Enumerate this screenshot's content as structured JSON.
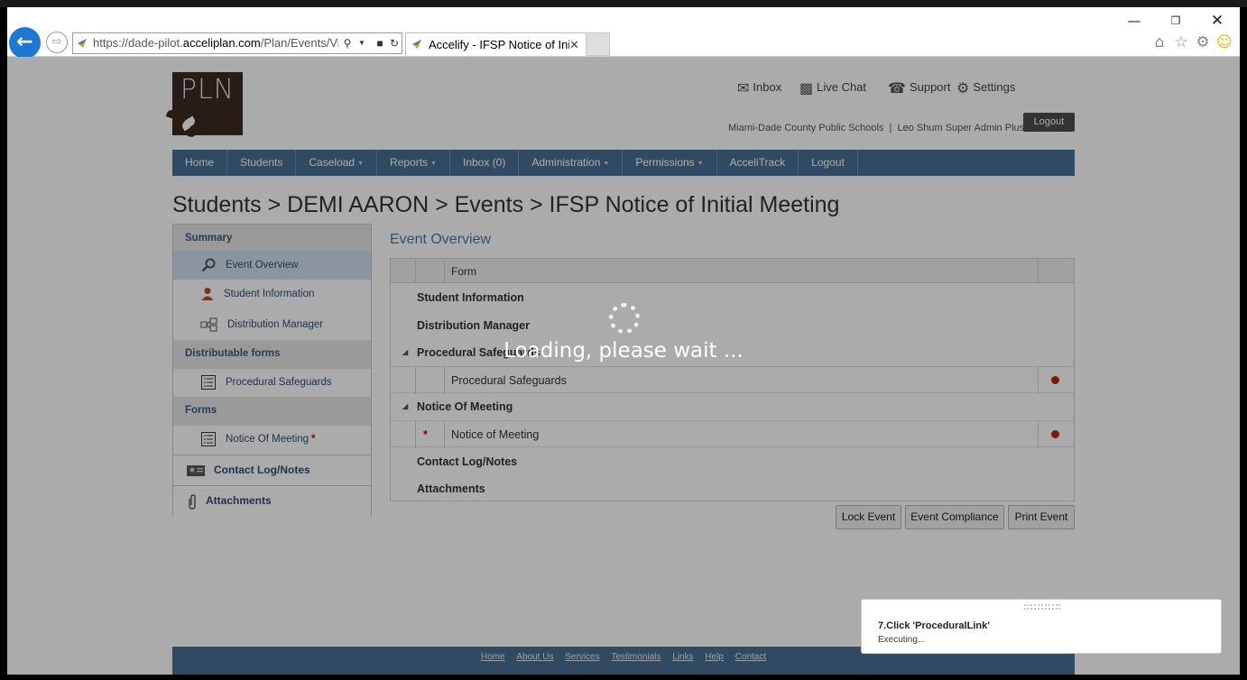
{
  "browser": {
    "url_prefix": "https://dade-pilot.",
    "url_domain": "acceliplan.com",
    "url_path": "/Plan/Events/Viev",
    "tab_title": "Accelify - IFSP Notice of Ini..."
  },
  "header": {
    "logo_text": "PLN",
    "links": {
      "inbox": "Inbox",
      "live_chat": "Live Chat",
      "support": "Support",
      "settings": "Settings"
    },
    "account": "Miami-Dade County Public Schools  |  Leo Shum Super Admin Plus",
    "logout": "Logout"
  },
  "nav": {
    "home": "Home",
    "students": "Students",
    "caseload": "Caseload",
    "reports": "Reports",
    "inbox": "Inbox (0)",
    "administration": "Administration",
    "permissions": "Permissions",
    "accelitrack": "AcceliTrack",
    "logout": "Logout"
  },
  "breadcrumb": "Students > DEMI AARON > Events > IFSP Notice of Initial Meeting",
  "sidebar": {
    "summary": "Summary",
    "event_overview": "Event Overview",
    "student_information": "Student Information",
    "distribution_manager": "Distribution Manager",
    "distributable_forms": "Distributable forms",
    "procedural_safeguards": "Procedural Safeguards",
    "forms": "Forms",
    "notice_of_meeting": "Notice Of Meeting",
    "required_mark": "*",
    "contact_log": "Contact Log/Notes",
    "attachments": "Attachments"
  },
  "main": {
    "title": "Event Overview",
    "grid": {
      "form_header": "Form",
      "student_information": "Student Information",
      "distribution_manager": "Distribution Manager",
      "procedural_group": "Procedural Safeguards",
      "procedural_item": "Procedural Safeguards",
      "notice_group": "Notice Of Meeting",
      "notice_item": "Notice of Meeting",
      "notice_required": "*",
      "contact_log": "Contact Log/Notes",
      "attachments": "Attachments"
    },
    "buttons": {
      "lock": "Lock Event",
      "compliance": "Event Compliance",
      "print": "Print Event"
    }
  },
  "footer": {
    "home": "Home",
    "about": "About Us",
    "services": "Services",
    "testimonials": "Testimonials",
    "links": "Links",
    "help": "Help",
    "contact": "Contact"
  },
  "overlay": {
    "loading_text": "Loading, please wait ..."
  },
  "toast": {
    "title": "7.Click 'ProceduralLink'",
    "status": "Executing..."
  },
  "colors": {
    "nav_bg": "#4a6f94",
    "accent_link": "#4a7aa8",
    "required": "#c00",
    "status_dot": "#c41e1e"
  }
}
